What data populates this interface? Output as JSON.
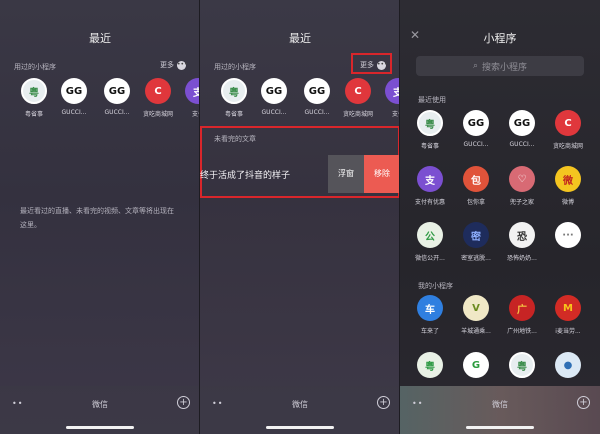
{
  "panel1": {
    "title": "最近",
    "used_label": "用过的小程序",
    "more_label": "更多",
    "apps": [
      {
        "label": "粤省事",
        "icon": "yuesheng-icon",
        "glyph": "粤"
      },
      {
        "label": "GUCCI...",
        "icon": "gucci-icon",
        "glyph": "GG"
      },
      {
        "label": "GUCCI...",
        "icon": "gucci-icon",
        "glyph": "GG"
      },
      {
        "label": "贪吃商城网",
        "icon": "tanchi-icon",
        "glyph": "C"
      },
      {
        "label": "支付",
        "icon": "zhifu-icon",
        "glyph": "支"
      }
    ],
    "empty_note": "最近看过的直播、未看完的视频、文章等将出现在这里。",
    "tab_label": "微信"
  },
  "panel2": {
    "title": "最近",
    "used_label": "用过的小程序",
    "more_label": "更多",
    "apps": [
      {
        "label": "粤省事",
        "icon": "yuesheng-icon",
        "glyph": "粤"
      },
      {
        "label": "GUCCI...",
        "icon": "gucci-icon",
        "glyph": "GG"
      },
      {
        "label": "GUCCI...",
        "icon": "gucci-icon",
        "glyph": "GG"
      },
      {
        "label": "贪吃商城网",
        "icon": "tanchi-icon",
        "glyph": "C"
      },
      {
        "label": "支付",
        "icon": "zhifu-icon",
        "glyph": "支"
      }
    ],
    "article_section_label": "未看完的文章",
    "article_title": "终于活成了抖音的样子",
    "float_label": "浮窗",
    "remove_label": "移除",
    "tab_label": "微信"
  },
  "panel3": {
    "title": "小程序",
    "search_placeholder": "搜索小程序",
    "recent_label": "最近使用",
    "recent_apps": [
      {
        "label": "粤省事",
        "icon": "yuesheng-icon",
        "glyph": "粤"
      },
      {
        "label": "GUCCI...",
        "icon": "gucci-icon",
        "glyph": "GG"
      },
      {
        "label": "GUCCI...",
        "icon": "gucci-icon",
        "glyph": "GG"
      },
      {
        "label": "贪吃商城网",
        "icon": "tanchi-icon",
        "glyph": "C"
      },
      {
        "label": "支付有优惠",
        "icon": "zhifu-icon",
        "glyph": "支"
      },
      {
        "label": "包你拿",
        "icon": "baoni-icon",
        "glyph": "包"
      },
      {
        "label": "兜子之家",
        "icon": "heart-icon",
        "glyph": "♡"
      },
      {
        "label": "微博",
        "icon": "weibo-icon",
        "glyph": "微"
      },
      {
        "label": "微信公开...",
        "icon": "wechat-public-icon",
        "glyph": "公"
      },
      {
        "label": "密室逃脱...",
        "icon": "escape-icon",
        "glyph": "密"
      },
      {
        "label": "恐怖奶奶...",
        "icon": "granny-icon",
        "glyph": "恐"
      },
      {
        "label": "",
        "icon": "more-dots-icon",
        "glyph": "···"
      }
    ],
    "mine_label": "我的小程序",
    "my_apps": [
      {
        "label": "车来了",
        "icon": "bus-icon",
        "glyph": "车"
      },
      {
        "label": "羊城通乘...",
        "icon": "yangcheng-icon",
        "glyph": "V"
      },
      {
        "label": "广州地铁...",
        "icon": "metro-icon",
        "glyph": "广"
      },
      {
        "label": "i麦当劳...",
        "icon": "mcdonalds-icon",
        "glyph": "M"
      },
      {
        "label": "",
        "icon": "app-icon",
        "glyph": "粤"
      },
      {
        "label": "",
        "icon": "app-icon",
        "glyph": "G"
      },
      {
        "label": "",
        "icon": "app-icon",
        "glyph": "粤"
      },
      {
        "label": "",
        "icon": "app-icon",
        "glyph": "●"
      }
    ],
    "tab_label": "微信"
  }
}
